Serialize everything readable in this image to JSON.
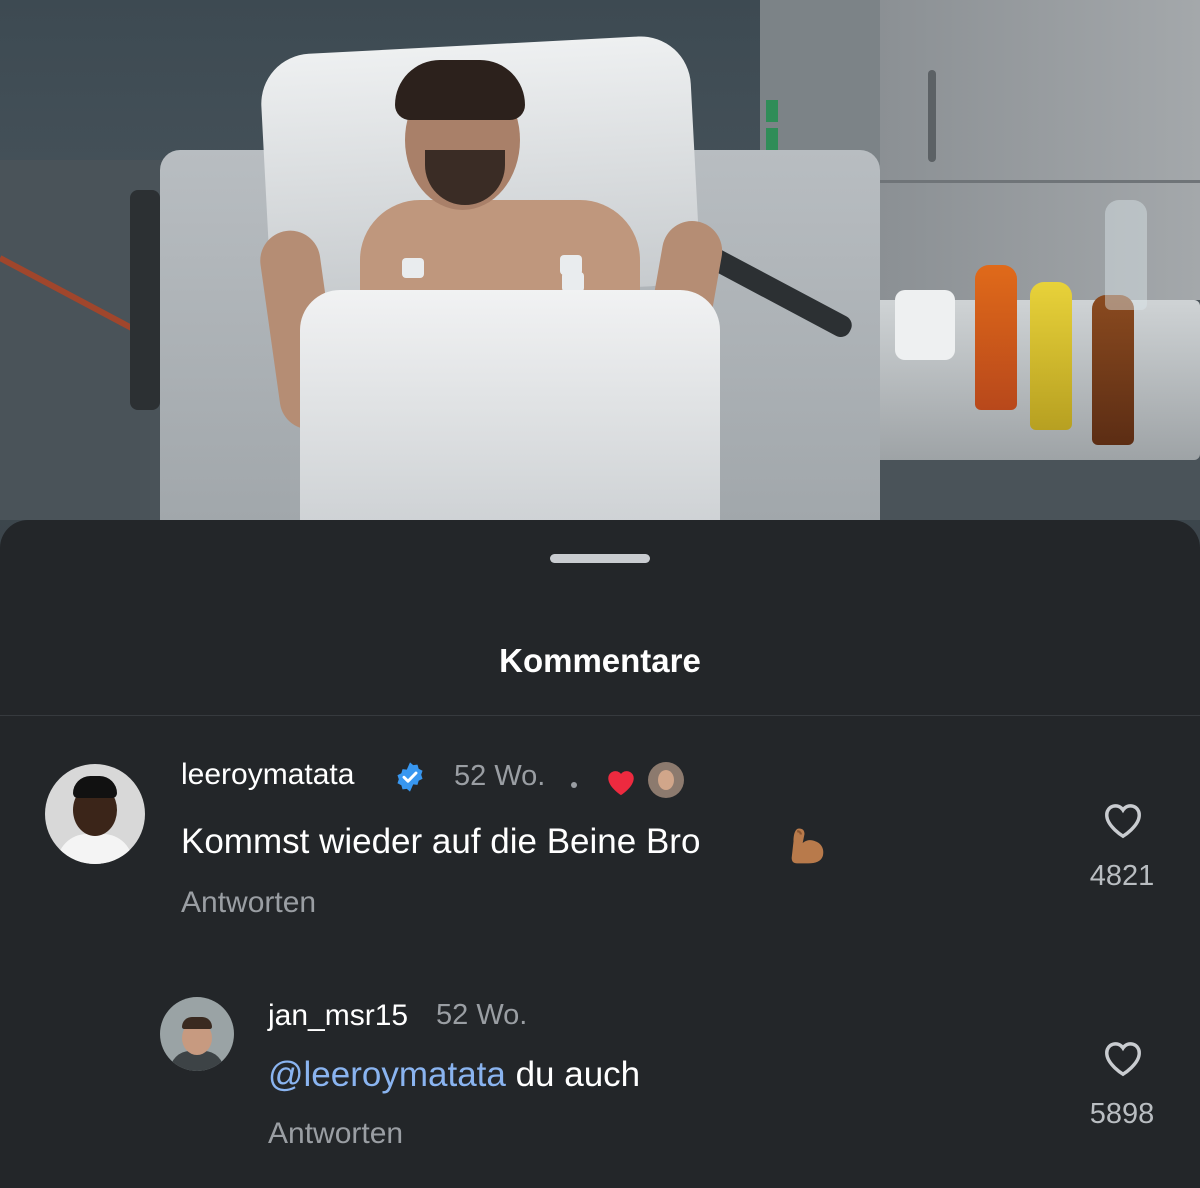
{
  "photo": {
    "icon": "hospital-photo"
  },
  "sheet": {
    "title": "Kommentare"
  },
  "comments": [
    {
      "username": "leeroymatata",
      "verified": true,
      "time": "52 Wo.",
      "text": "Kommst wieder auf die Beine Bro",
      "emoji": "flexed-biceps",
      "liked_by_creator": true,
      "reply_label": "Antworten",
      "likes": "4821"
    },
    {
      "username": "jan_msr15",
      "time": "52 Wo.",
      "mention": "@leeroymatata",
      "text": " du auch",
      "reply_label": "Antworten",
      "likes": "5898"
    }
  ],
  "colors": {
    "background": "#232629",
    "mention": "#8ab4f0",
    "verified": "#3897f0",
    "heart": "#ed2a3f",
    "muted": "#9a9ea3"
  }
}
